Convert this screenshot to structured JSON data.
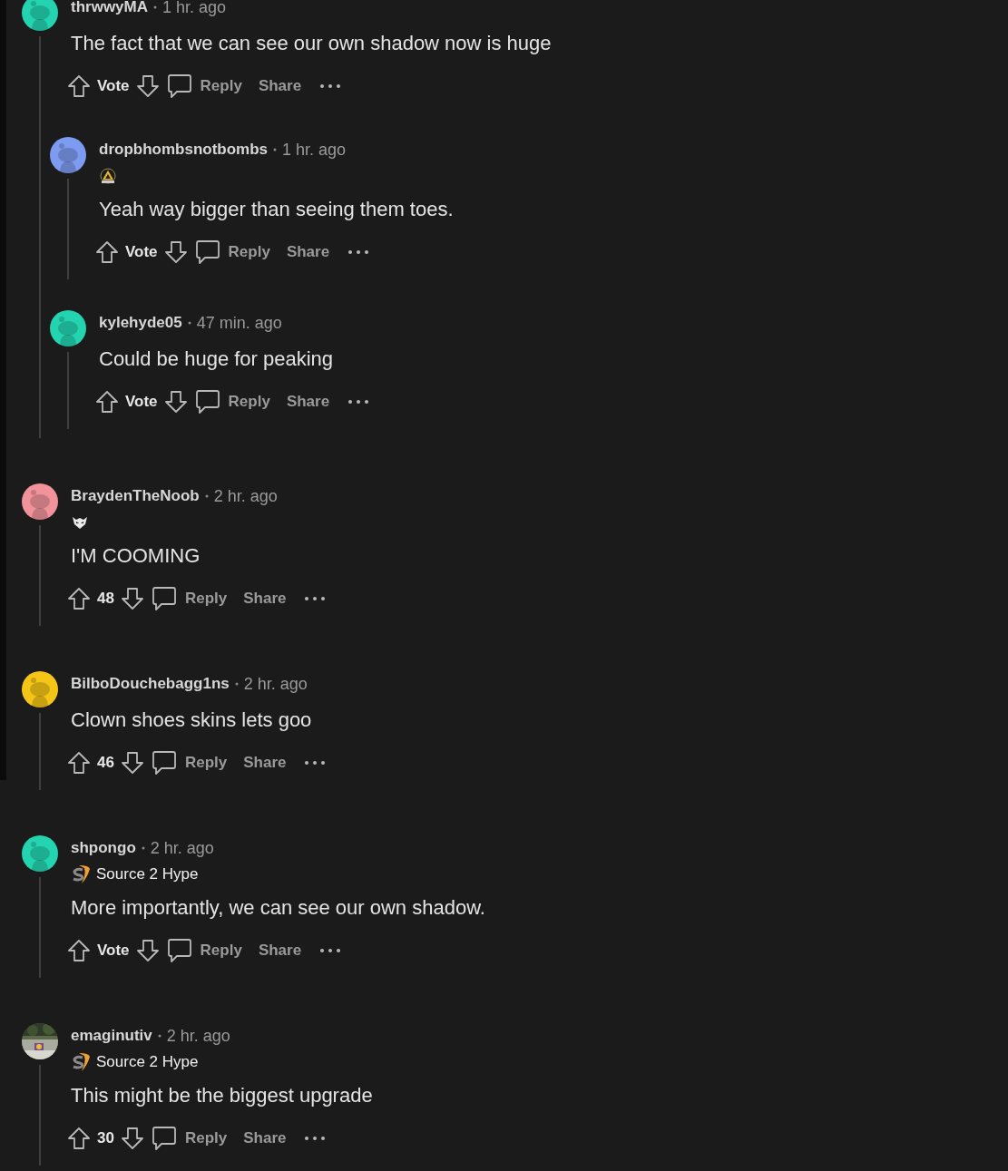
{
  "comments": [
    {
      "username": "thrwwyMA",
      "time": "1 hr. ago",
      "avatar": {
        "kind": "snoo",
        "color": "#24d3b0"
      },
      "body": "The fact that we can see our own shadow now is huge",
      "votes": "Vote",
      "actions": [
        "Reply",
        "Share"
      ],
      "replies": [
        {
          "username": "dropbhombsnotbombs",
          "time": "1 hr. ago",
          "avatar": {
            "kind": "snoo",
            "color": "#7d9bf0"
          },
          "flair": {
            "kind": "triangle"
          },
          "body": "Yeah way bigger than seeing them toes.",
          "votes": "Vote",
          "actions": [
            "Reply",
            "Share"
          ]
        },
        {
          "username": "kylehyde05",
          "time": "47 min. ago",
          "avatar": {
            "kind": "snoo",
            "color": "#24d3b0"
          },
          "body": "Could be huge for peaking",
          "votes": "Vote",
          "actions": [
            "Reply",
            "Share"
          ]
        }
      ]
    },
    {
      "username": "BraydenTheNoob",
      "time": "2 hr. ago",
      "avatar": {
        "kind": "snoo",
        "color": "#f2939b"
      },
      "flair": {
        "kind": "mask"
      },
      "body": "I'M COOMING",
      "votes": "48",
      "actions": [
        "Reply",
        "Share"
      ]
    },
    {
      "username": "BilboDouchebagg1ns",
      "time": "2 hr. ago",
      "avatar": {
        "kind": "snoo",
        "color": "#f5c518"
      },
      "body": "Clown shoes skins lets goo",
      "votes": "46",
      "actions": [
        "Reply",
        "Share"
      ]
    },
    {
      "username": "shpongo",
      "time": "2 hr. ago",
      "avatar": {
        "kind": "snoo",
        "color": "#24d3b0"
      },
      "flair": {
        "kind": "source",
        "text": "Source 2 Hype"
      },
      "body": "More importantly, we can see our own shadow.",
      "votes": "Vote",
      "actions": [
        "Reply",
        "Share"
      ]
    },
    {
      "username": "emaginutiv",
      "time": "2 hr. ago",
      "flair": {
        "kind": "source",
        "text": "Source 2 Hype"
      },
      "body": "This might be the biggest upgrade",
      "votes": "30",
      "actions": [
        "Reply",
        "Share"
      ]
    }
  ]
}
